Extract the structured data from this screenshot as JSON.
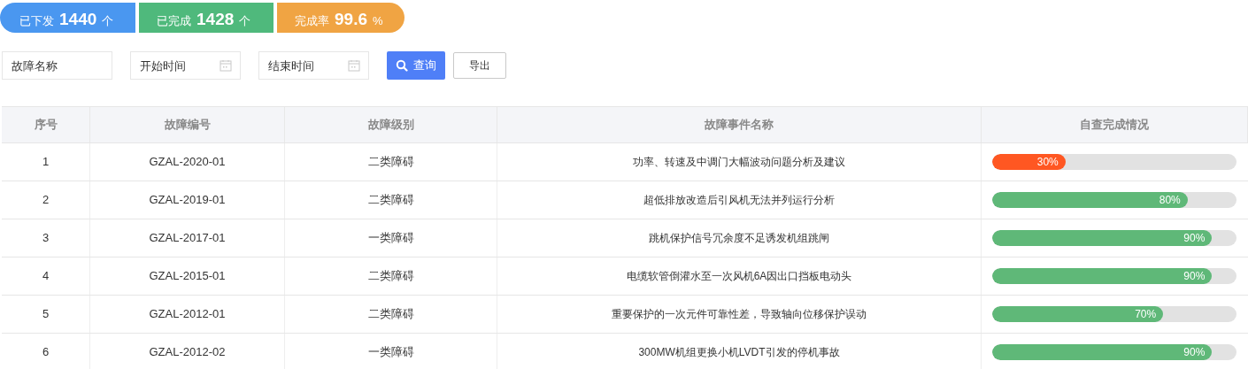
{
  "stats": [
    {
      "label": "已下发",
      "value": "1440",
      "unit": "个",
      "color": "#4a97f0"
    },
    {
      "label": "已完成",
      "value": "1428",
      "unit": "个",
      "color": "#4fb97c"
    },
    {
      "label": "完成率",
      "value": "99.6",
      "unit": "%",
      "color": "#f0a443"
    }
  ],
  "filters": [
    {
      "kind": "text",
      "placeholder": "故障名称"
    },
    {
      "kind": "date",
      "placeholder": "开始时间"
    },
    {
      "kind": "date",
      "placeholder": "结束时间"
    }
  ],
  "buttons": [
    {
      "kind": "primary",
      "label": "查询"
    },
    {
      "kind": "plain",
      "label": "导出"
    }
  ],
  "table": {
    "columns": [
      "序号",
      "故障编号",
      "故障级别",
      "故障事件名称",
      "自查完成情况"
    ],
    "rows": [
      {
        "index": "1",
        "code": "GZAL-2020-01",
        "level_name": "二类障碍",
        "event": "功率、转速及中调门大幅波动问题分析及建议",
        "progress": {
          "level": 0.3,
          "reading": "30%",
          "color": "#ff5722"
        }
      },
      {
        "index": "2",
        "code": "GZAL-2019-01",
        "level_name": "二类障碍",
        "event": "超低排放改造后引风机无法并列运行分析",
        "progress": {
          "level": 0.8,
          "reading": "80%",
          "color": "#5fb878"
        }
      },
      {
        "index": "3",
        "code": "GZAL-2017-01",
        "level_name": "一类障碍",
        "event": "跳机保护信号冗余度不足诱发机组跳闸",
        "progress": {
          "level": 0.9,
          "reading": "90%",
          "color": "#5fb878"
        }
      },
      {
        "index": "4",
        "code": "GZAL-2015-01",
        "level_name": "二类障碍",
        "event": "电缆软管倒灌水至一次风机6A因出口挡板电动头",
        "progress": {
          "level": 0.9,
          "reading": "90%",
          "color": "#5fb878"
        }
      },
      {
        "index": "5",
        "code": "GZAL-2012-01",
        "level_name": "二类障碍",
        "event": "重要保护的一次元件可靠性差，导致轴向位移保护误动",
        "progress": {
          "level": 0.7,
          "reading": "70%",
          "color": "#5fb878"
        }
      },
      {
        "index": "6",
        "code": "GZAL-2012-02",
        "level_name": "一类障碍",
        "event": "300MW机组更换小机LVDT引发的停机事故",
        "progress": {
          "level": 0.9,
          "reading": "90%",
          "color": "#5fb878"
        }
      }
    ]
  }
}
